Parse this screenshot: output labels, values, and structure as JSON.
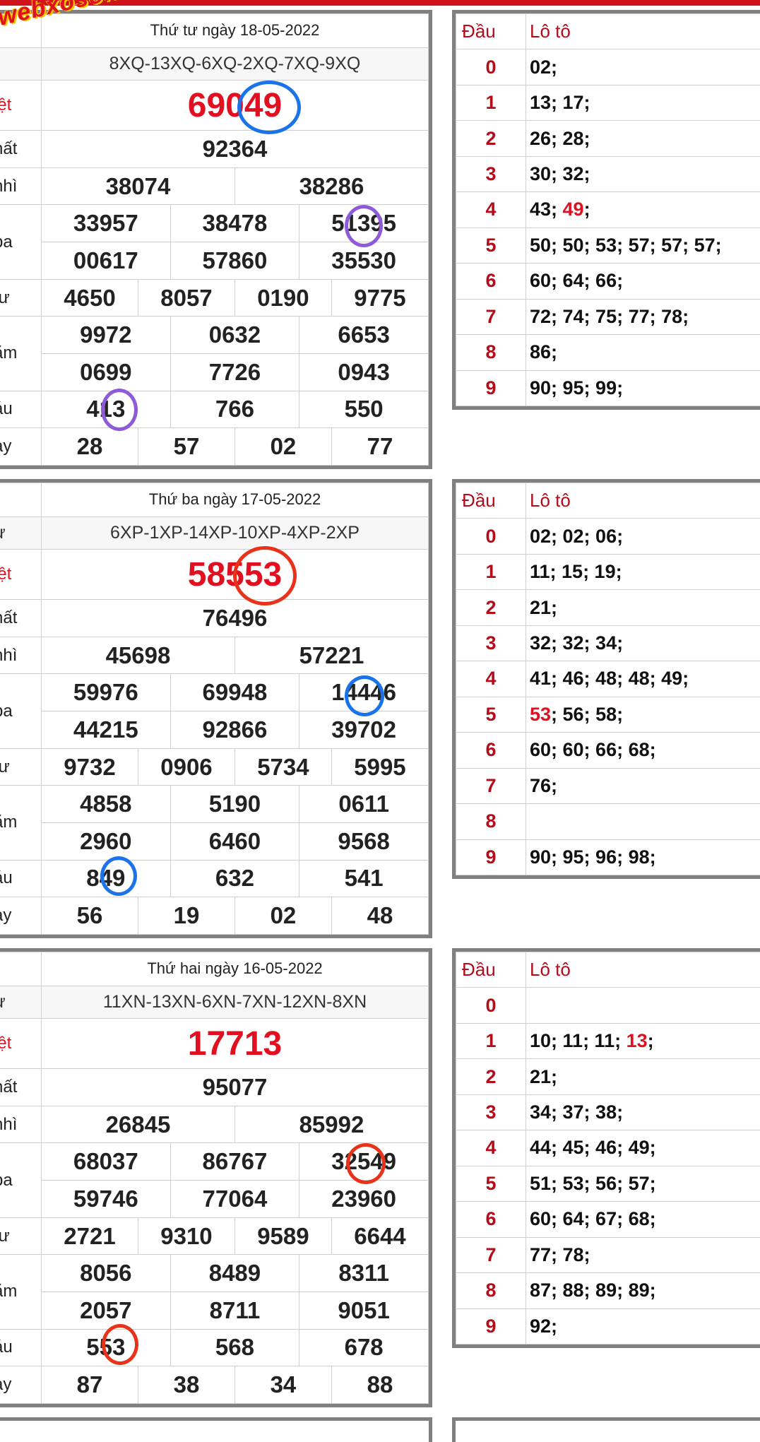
{
  "brand": {
    "logo_text": "webxoso.net"
  },
  "colors": {
    "accent_red": "#e01020",
    "loto_red": "#b30d1b",
    "frame_gray": "#808080",
    "circle_blue": "#1a73e8",
    "circle_purple": "#8e5bd8",
    "circle_red": "#e8321a"
  },
  "labels": {
    "g0": "iệt",
    "g1": "hất",
    "g2": "nhì",
    "g3": "ba",
    "g4": "tư",
    "g5": "ăm",
    "g6": "áu",
    "g7": "ảy",
    "code_lbl": "ự",
    "loto_head": "Đầu",
    "loto_vals_head": "Lô tô"
  },
  "blocks": [
    {
      "date": "Thứ tư ngày 18-05-2022",
      "code": "8XQ-13XQ-6XQ-2XQ-7XQ-9XQ",
      "show_code_label": false,
      "db": "69049",
      "g1": "92364",
      "g2": [
        "38074",
        "38286"
      ],
      "g3": [
        "33957",
        "38478",
        "51395",
        "00617",
        "57860",
        "35530"
      ],
      "g4": [
        "4650",
        "8057",
        "0190",
        "9775"
      ],
      "g5": [
        "9972",
        "0632",
        "6653",
        "0699",
        "7726",
        "0943"
      ],
      "g6": [
        "413",
        "766",
        "550"
      ],
      "g7": [
        "28",
        "57",
        "02",
        "77"
      ],
      "loto": [
        {
          "d": "0",
          "v": [
            {
              "t": "02;"
            }
          ]
        },
        {
          "d": "1",
          "v": [
            {
              "t": "13; 17;"
            }
          ]
        },
        {
          "d": "2",
          "v": [
            {
              "t": "26; 28;"
            }
          ]
        },
        {
          "d": "3",
          "v": [
            {
              "t": "30; 32;"
            }
          ]
        },
        {
          "d": "4",
          "v": [
            {
              "t": "43; "
            },
            {
              "t": "49",
              "red": true
            },
            {
              "t": ";"
            }
          ]
        },
        {
          "d": "5",
          "v": [
            {
              "t": "50; 50; 53; 57; 57; 57;"
            }
          ]
        },
        {
          "d": "6",
          "v": [
            {
              "t": "60; 64; 66;"
            }
          ]
        },
        {
          "d": "7",
          "v": [
            {
              "t": "72; 74; 75; 77; 78;"
            }
          ]
        },
        {
          "d": "8",
          "v": [
            {
              "t": "86;"
            }
          ]
        },
        {
          "d": "9",
          "v": [
            {
              "t": "90; 95; 99;"
            }
          ]
        }
      ]
    },
    {
      "date": "Thứ ba ngày 17-05-2022",
      "code": "6XP-1XP-14XP-10XP-4XP-2XP",
      "show_code_label": true,
      "db": "58553",
      "g1": "76496",
      "g2": [
        "45698",
        "57221"
      ],
      "g3": [
        "59976",
        "69948",
        "14446",
        "44215",
        "92866",
        "39702"
      ],
      "g4": [
        "9732",
        "0906",
        "5734",
        "5995"
      ],
      "g5": [
        "4858",
        "5190",
        "0611",
        "2960",
        "6460",
        "9568"
      ],
      "g6": [
        "849",
        "632",
        "541"
      ],
      "g7": [
        "56",
        "19",
        "02",
        "48"
      ],
      "loto": [
        {
          "d": "0",
          "v": [
            {
              "t": "02; 02; 06;"
            }
          ]
        },
        {
          "d": "1",
          "v": [
            {
              "t": "11; 15; 19;"
            }
          ]
        },
        {
          "d": "2",
          "v": [
            {
              "t": "21;"
            }
          ]
        },
        {
          "d": "3",
          "v": [
            {
              "t": "32; 32; 34;"
            }
          ]
        },
        {
          "d": "4",
          "v": [
            {
              "t": "41; 46; 48; 48; 49;"
            }
          ]
        },
        {
          "d": "5",
          "v": [
            {
              "t": "53",
              "red": true
            },
            {
              "t": "; 56; 58;"
            }
          ]
        },
        {
          "d": "6",
          "v": [
            {
              "t": "60; 60; 66; 68;"
            }
          ]
        },
        {
          "d": "7",
          "v": [
            {
              "t": "76;"
            }
          ]
        },
        {
          "d": "8",
          "v": []
        },
        {
          "d": "9",
          "v": [
            {
              "t": "90; 95; 96; 98;"
            }
          ]
        }
      ]
    },
    {
      "date": "Thứ hai ngày 16-05-2022",
      "code": "11XN-13XN-6XN-7XN-12XN-8XN",
      "show_code_label": true,
      "db": "17713",
      "g1": "95077",
      "g2": [
        "26845",
        "85992"
      ],
      "g3": [
        "68037",
        "86767",
        "32549",
        "59746",
        "77064",
        "23960"
      ],
      "g4": [
        "2721",
        "9310",
        "9589",
        "6644"
      ],
      "g5": [
        "8056",
        "8489",
        "8311",
        "2057",
        "8711",
        "9051"
      ],
      "g6": [
        "553",
        "568",
        "678"
      ],
      "g7": [
        "87",
        "38",
        "34",
        "88"
      ],
      "loto": [
        {
          "d": "0",
          "v": []
        },
        {
          "d": "1",
          "v": [
            {
              "t": "10; 11; 11; "
            },
            {
              "t": "13",
              "red": true
            },
            {
              "t": ";"
            }
          ]
        },
        {
          "d": "2",
          "v": [
            {
              "t": "21;"
            }
          ]
        },
        {
          "d": "3",
          "v": [
            {
              "t": "34; 37; 38;"
            }
          ]
        },
        {
          "d": "4",
          "v": [
            {
              "t": "44; 45; 46; 49;"
            }
          ]
        },
        {
          "d": "5",
          "v": [
            {
              "t": "51; 53; 56; 57;"
            }
          ]
        },
        {
          "d": "6",
          "v": [
            {
              "t": "60; 64; 67; 68;"
            }
          ]
        },
        {
          "d": "7",
          "v": [
            {
              "t": "77; 78;"
            }
          ]
        },
        {
          "d": "8",
          "v": [
            {
              "t": "87; 88; 89; 89;"
            }
          ]
        },
        {
          "d": "9",
          "v": [
            {
              "t": "92;"
            }
          ]
        }
      ]
    }
  ]
}
